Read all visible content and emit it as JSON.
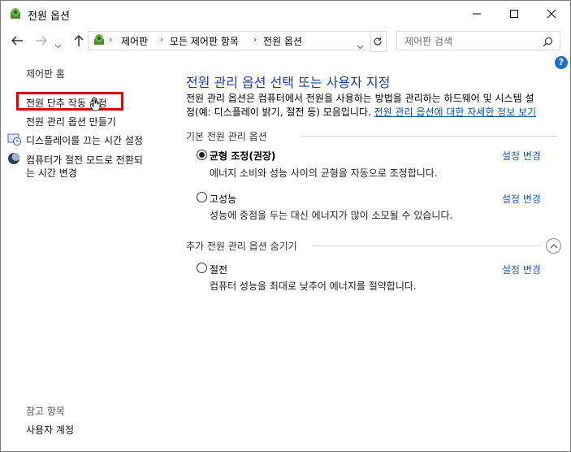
{
  "window": {
    "title": "전원 옵션"
  },
  "address": {
    "crumbs": [
      "제어판",
      "모든 제어판 항목",
      "전원 옵션"
    ],
    "search_placeholder": "제어판 검색"
  },
  "sidebar": {
    "home": "제어판 홈",
    "links": [
      "전원 단추 작동 설정",
      "전원 관리 옵션 만들기",
      "디스플레이를 끄는 시간 설정",
      "컴퓨터가 절전 모드로 전환되",
      "는 시간 변경"
    ],
    "see_also": "참고 항목",
    "user_accounts": "사용자 계정"
  },
  "main": {
    "heading": "전원 관리 옵션 선택 또는 사용자 지정",
    "desc_line1": "전원 관리 옵션은 컴퓨터에서 전원을 사용하는 방법을 관리하는 하드웨어 및 시스템 설",
    "desc_line2": "정(예: 디스플레이 밝기, 절전 등) 모음입니다.",
    "desc_link": "전원 관리 옵션에 대한 자세한 정보 보기",
    "group_basic": "기본 전원 관리 옵션",
    "group_hidden": "추가 전원 관리 옵션 숨기기",
    "change_label": "설정 변경",
    "plans": [
      {
        "name": "균형 조정(권장)",
        "desc": "에너지 소비와 성능 사이의 균형을 자동으로 조정합니다.",
        "selected": true
      },
      {
        "name": "고성능",
        "desc": "성능에 중점을 두는 대신 에너지가 많이 소모될 수 있습니다.",
        "selected": false
      },
      {
        "name": "절전",
        "desc": "컴퓨터 성능을 최대로 낮추어 에너지를 절약합니다.",
        "selected": false
      }
    ]
  },
  "colors": {
    "heading": "#1e3d96",
    "link": "#0058b0",
    "highlight": "#e00000"
  }
}
